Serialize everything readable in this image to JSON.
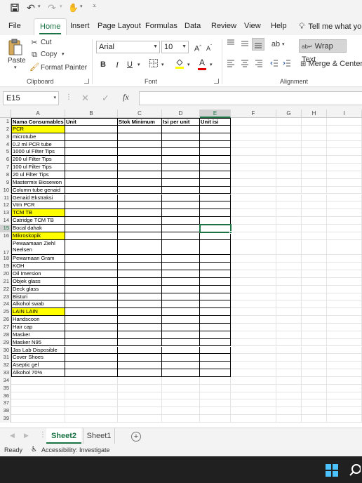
{
  "ribbon_tabs": [
    "File",
    "Home",
    "Insert",
    "Page Layout",
    "Formulas",
    "Data",
    "Review",
    "View",
    "Help"
  ],
  "active_tab": "Home",
  "tell_me": "Tell me what yo",
  "clipboard": {
    "paste": "Paste",
    "cut": "Cut",
    "copy": "Copy",
    "format_painter": "Format Painter",
    "group_label": "Clipboard"
  },
  "font": {
    "name": "Arial",
    "size": "10",
    "grow": "A",
    "shrink": "A",
    "bold": "B",
    "italic": "I",
    "underline": "U",
    "font_color_letter": "A",
    "group_label": "Font"
  },
  "alignment": {
    "wrap_text": "Wrap Text",
    "merge_center": "Merge & Center",
    "group_label": "Alignment"
  },
  "formula_bar": {
    "name_box": "E15",
    "fx": "fx",
    "value": ""
  },
  "columns": [
    "A",
    "B",
    "C",
    "D",
    "E",
    "F",
    "G",
    "H",
    "I"
  ],
  "rows": [
    {
      "n": "1",
      "a": "Nama Consumables",
      "b": "Unit",
      "c": "Stok Minimum",
      "d": "Isi per unit",
      "e": "Unit isi"
    },
    {
      "n": "2",
      "a": "PCR"
    },
    {
      "n": "3",
      "a": "microtube"
    },
    {
      "n": "4",
      "a": "0.2 ml PCR tube"
    },
    {
      "n": "5",
      "a": "1000 ul Filter Tips"
    },
    {
      "n": "6",
      "a": "200 ul Filter Tips"
    },
    {
      "n": "7",
      "a": "100 ul Filter Tips"
    },
    {
      "n": "8",
      "a": "20 ul Filter Tips"
    },
    {
      "n": "9",
      "a": "Mastermix Biosewon"
    },
    {
      "n": "10",
      "a": "Column tube genaid"
    },
    {
      "n": "11",
      "a": "Genaid Ekstraksi"
    },
    {
      "n": "12",
      "a": "Vtm PCR"
    },
    {
      "n": "13",
      "a": "TCM TB"
    },
    {
      "n": "14",
      "a": "Catridge TCM TB"
    },
    {
      "n": "15",
      "a": "Bocal dahak"
    },
    {
      "n": "16",
      "a": "Mikroskopik"
    },
    {
      "n": "17",
      "a": "Pewaamaan Ziehl Neelsen"
    },
    {
      "n": "18",
      "a": "Pewarnaan Gram"
    },
    {
      "n": "19",
      "a": "KOH"
    },
    {
      "n": "20",
      "a": "Oil Imersion"
    },
    {
      "n": "21",
      "a": "Objek glass"
    },
    {
      "n": "22",
      "a": "Deck glass"
    },
    {
      "n": "23",
      "a": "Bisturi"
    },
    {
      "n": "24",
      "a": "Alkohol swab"
    },
    {
      "n": "25",
      "a": "LAIN LAIN"
    },
    {
      "n": "26",
      "a": "Handscoon"
    },
    {
      "n": "27",
      "a": "Hair cap"
    },
    {
      "n": "28",
      "a": "Masker"
    },
    {
      "n": "29",
      "a": "Masker N95"
    },
    {
      "n": "30",
      "a": "Jas Lab Disposible"
    },
    {
      "n": "31",
      "a": "Cover Shoes"
    },
    {
      "n": "32",
      "a": "Aseptic gel"
    },
    {
      "n": "33",
      "a": "Alkohol 70%"
    },
    {
      "n": "34"
    },
    {
      "n": "35"
    },
    {
      "n": "36"
    },
    {
      "n": "37"
    },
    {
      "n": "38"
    },
    {
      "n": "39"
    }
  ],
  "highlight_color": "#ffff00",
  "accent_color": "#1a7343",
  "sheets": [
    "Sheet2",
    "Sheet1"
  ],
  "active_sheet": "Sheet2",
  "status": {
    "ready": "Ready",
    "accessibility": "Accessibility: Investigate"
  }
}
